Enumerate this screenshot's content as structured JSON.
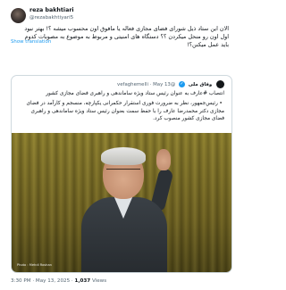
{
  "author": {
    "name": "reza bakhtiari",
    "handle": "@rezabakhtiyari5"
  },
  "translate_label": "Show translation",
  "tweet_text": "الان این ستاد ذیل شورای فضای مجازی فعاله یا مافوق اون محسوب میشه ؟! بهتر نبود اول اون رو منحل میکردن ؟؟ دستگاه های امنیتی و مربوط به موضوع به مصوبات کدوم باید عمل میکنن؟!",
  "quoted": {
    "name": "وفاق ملی",
    "handle": "@vefaghemelli",
    "date": "May 13",
    "separator": "·",
    "verified_glyph": "✓",
    "paragraph1": "انتصاب #عارف به عنوان رئیس ستاد ویژه ساماندهی و راهبری فضای مجازی کشور",
    "paragraph2": "▪️رئیس‌جمهور، نظر به ضرورت فوری استقرار حکمرانی یکپارچه، منسجم و کارآمد در فضای مجازی دکتر محمدرضا عارف را با حفظ سمت بعنوان رئیس ستاد ویژه ساماندهی و راهبری فضای مجازی کشور منصوب کرد.",
    "photo_credit": "Photo : Mehdi Roshan"
  },
  "meta": {
    "time": "3:30 PM · May 13, 2025 ·",
    "views_count": "1,037",
    "views_label": "Views"
  },
  "colors": {
    "link": "#1d9bf0",
    "secondary_text": "#536471",
    "border": "#cfd9de"
  }
}
